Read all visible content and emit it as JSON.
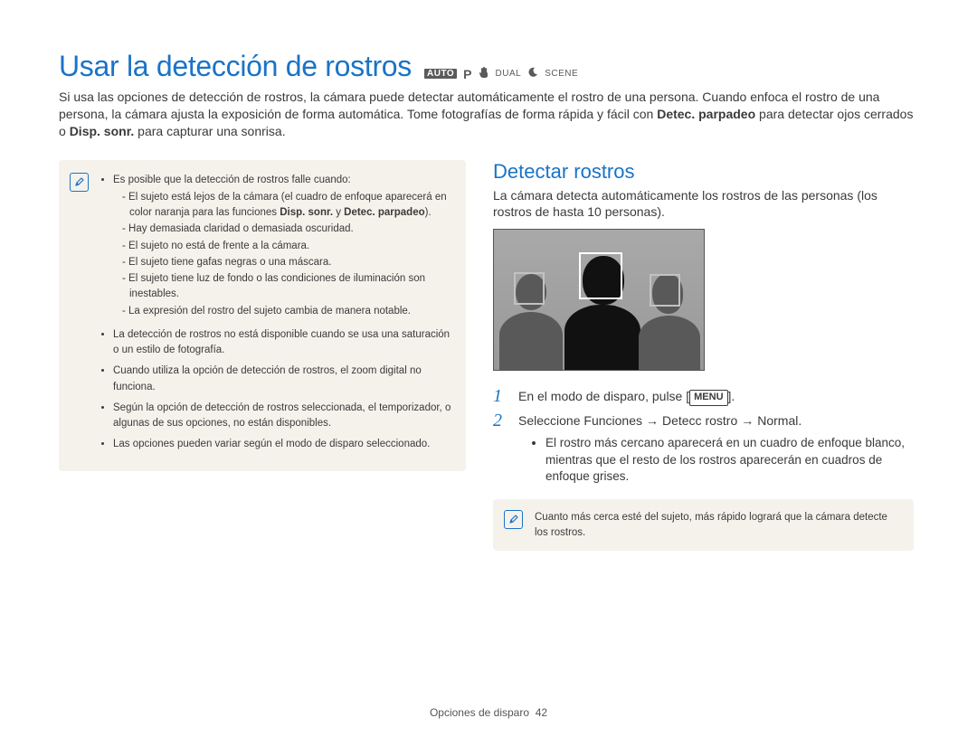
{
  "header": {
    "title": "Usar la detección de rostros",
    "modes": {
      "auto": "AUTO",
      "p": "P",
      "dual": "DUAL",
      "scene": "SCENE"
    }
  },
  "intro": {
    "text_a": "Si usa las opciones de detección de rostros, la cámara puede detectar automáticamente el rostro de una persona. Cuando enfoca el rostro de una persona, la cámara ajusta la exposición de forma automática. Tome fotografías de forma rápida y fácil con ",
    "bold_a": "Detec. parpadeo",
    "text_b": " para detectar ojos cerrados o ",
    "bold_b": "Disp. sonr.",
    "text_c": " para capturar una sonrisa."
  },
  "notebox": {
    "item1_lead": "Es posible que la detección de rostros falle cuando:",
    "item1_sub1_a": "El sujeto está lejos de la cámara (el cuadro de enfoque aparecerá en color naranja para las funciones ",
    "item1_sub1_b1": "Disp. sonr.",
    "item1_sub1_mid": " y ",
    "item1_sub1_b2": "Detec. parpadeo",
    "item1_sub1_end": ").",
    "item1_sub2": "Hay demasiada claridad o demasiada oscuridad.",
    "item1_sub3": "El sujeto no está de frente a la cámara.",
    "item1_sub4": "El sujeto tiene gafas negras o una máscara.",
    "item1_sub5": "El sujeto tiene luz de fondo o las condiciones de iluminación son inestables.",
    "item1_sub6": "La expresión del rostro del sujeto cambia de manera notable.",
    "item2": "La detección de rostros no está disponible cuando se usa una saturación o un estilo de fotografía.",
    "item3": "Cuando utiliza la opción de detección de rostros, el zoom digital no funciona.",
    "item4": "Según la opción de detección de rostros seleccionada, el temporizador, o algunas de sus opciones, no están disponibles.",
    "item5": "Las opciones pueden variar según el modo de disparo seleccionado."
  },
  "right": {
    "heading": "Detectar rostros",
    "intro": "La cámara detecta automáticamente los rostros de las personas (los rostros de hasta 10 personas).",
    "step1_a": "En el modo de disparo, pulse [",
    "step1_menu": "MENU",
    "step1_b": "].",
    "step2_a": "Seleccione ",
    "step2_b1": "Funciones",
    "step2_arrow": "→",
    "step2_b2": "Detecc rostro",
    "step2_b3": "Normal",
    "step2_end": ".",
    "step2_sub": "El rostro más cercano aparecerá en un cuadro de enfoque blanco, mientras que el resto de los rostros aparecerán en cuadros de enfoque grises.",
    "tip": "Cuanto más cerca esté del sujeto, más rápido logrará que la cámara detecte los rostros."
  },
  "footer": {
    "section": "Opciones de disparo",
    "page": "42"
  }
}
